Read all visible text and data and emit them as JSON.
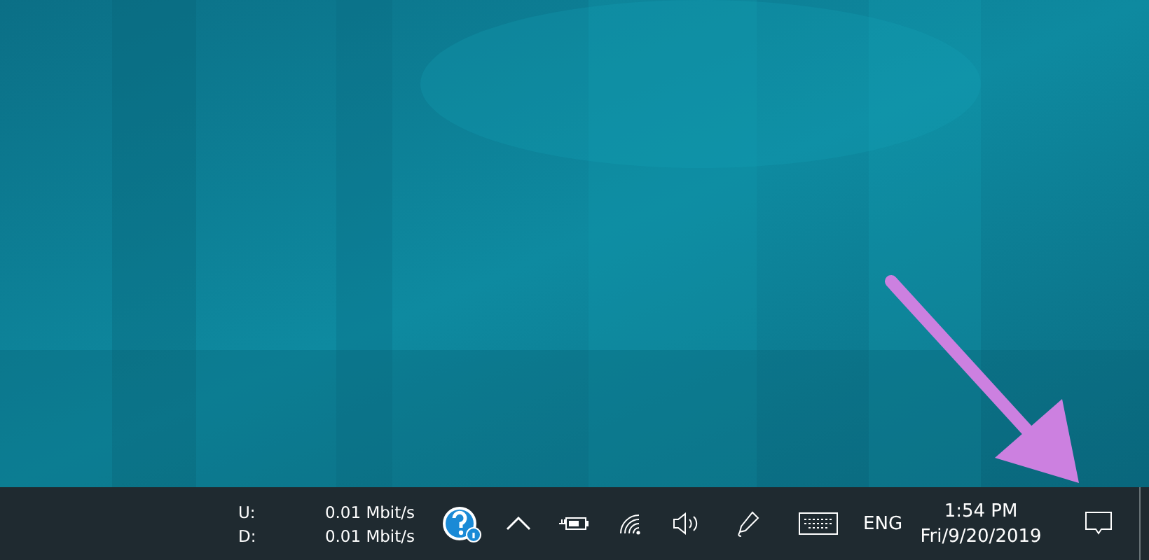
{
  "taskbar": {
    "net_speed": [
      {
        "label": "U:",
        "value": "0.01 Mbit/s"
      },
      {
        "label": "D:",
        "value": "0.01 Mbit/s"
      }
    ],
    "language": "ENG",
    "clock": {
      "time": "1:54 PM",
      "date": "Fri/9/20/2019"
    }
  }
}
